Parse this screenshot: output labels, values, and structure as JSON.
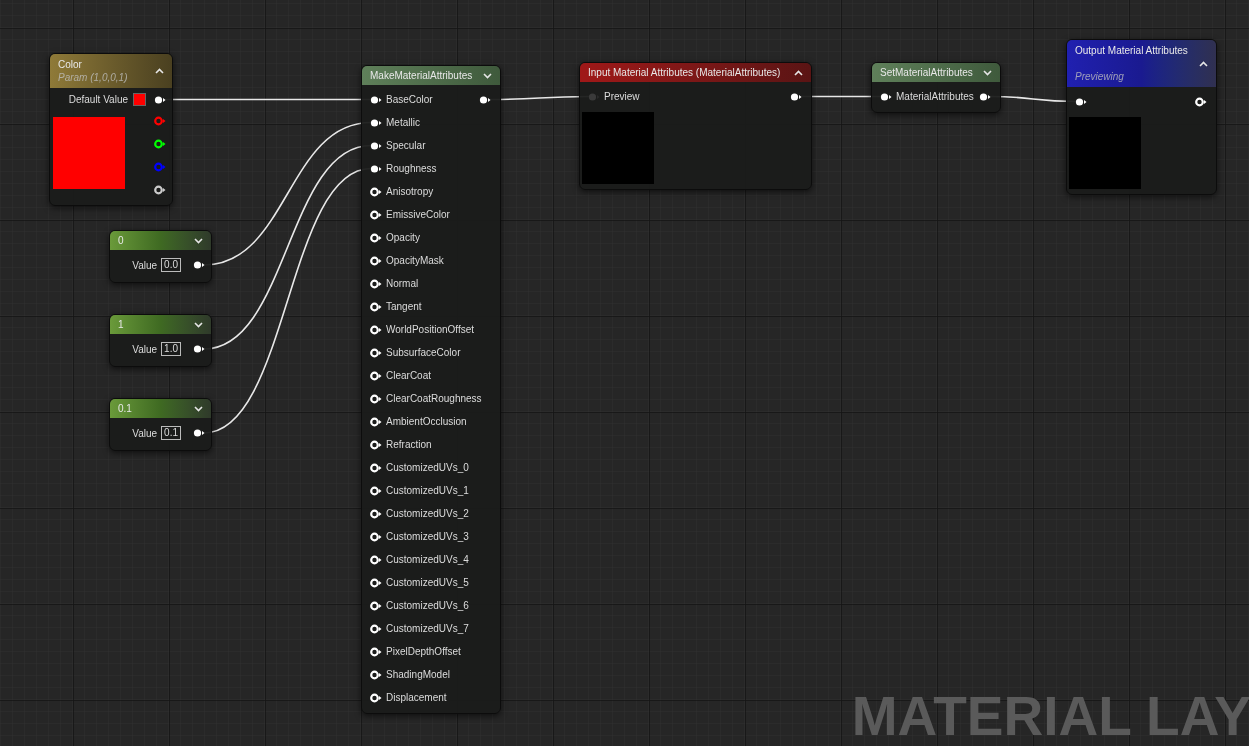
{
  "nodes": [
    {
      "kind": "param",
      "title": "Color",
      "subtitle": "Param (1,0,0,1)",
      "expanded": true,
      "default_label": "Default Value",
      "outputs": [
        {
          "color": "#ffffff",
          "connected": true
        },
        {
          "color": "#ff0000",
          "connected": false
        },
        {
          "color": "#00ff00",
          "connected": false
        },
        {
          "color": "#0000ff",
          "connected": false
        },
        {
          "color": "#cccccc",
          "connected": false
        }
      ]
    },
    {
      "kind": "constant",
      "title": "0",
      "expanded": false,
      "value_label": "Value",
      "value": "0.0",
      "outputs": [
        {
          "color": "#ffffff",
          "connected": true
        }
      ]
    },
    {
      "kind": "constant",
      "title": "1",
      "expanded": false,
      "value_label": "Value",
      "value": "1.0",
      "outputs": [
        {
          "color": "#ffffff",
          "connected": true
        }
      ]
    },
    {
      "kind": "constant",
      "title": "0.1",
      "expanded": false,
      "value_label": "Value",
      "value": "0.1",
      "outputs": [
        {
          "color": "#ffffff",
          "connected": true
        }
      ]
    },
    {
      "kind": "function",
      "title": "MakeMaterialAttributes",
      "expanded": false,
      "inputs": [
        {
          "label": "BaseColor",
          "connected": true
        },
        {
          "label": "Metallic",
          "connected": true
        },
        {
          "label": "Specular",
          "connected": true
        },
        {
          "label": "Roughness",
          "connected": true
        },
        {
          "label": "Anisotropy",
          "connected": false
        },
        {
          "label": "EmissiveColor",
          "connected": false
        },
        {
          "label": "Opacity",
          "connected": false
        },
        {
          "label": "OpacityMask",
          "connected": false
        },
        {
          "label": "Normal",
          "connected": false
        },
        {
          "label": "Tangent",
          "connected": false
        },
        {
          "label": "WorldPositionOffset",
          "connected": false
        },
        {
          "label": "SubsurfaceColor",
          "connected": false
        },
        {
          "label": "ClearCoat",
          "connected": false
        },
        {
          "label": "ClearCoatRoughness",
          "connected": false
        },
        {
          "label": "AmbientOcclusion",
          "connected": false
        },
        {
          "label": "Refraction",
          "connected": false
        },
        {
          "label": "CustomizedUVs_0",
          "connected": false
        },
        {
          "label": "CustomizedUVs_1",
          "connected": false
        },
        {
          "label": "CustomizedUVs_2",
          "connected": false
        },
        {
          "label": "CustomizedUVs_3",
          "connected": false
        },
        {
          "label": "CustomizedUVs_4",
          "connected": false
        },
        {
          "label": "CustomizedUVs_5",
          "connected": false
        },
        {
          "label": "CustomizedUVs_6",
          "connected": false
        },
        {
          "label": "CustomizedUVs_7",
          "connected": false
        },
        {
          "label": "PixelDepthOffset",
          "connected": false
        },
        {
          "label": "ShadingModel",
          "connected": false
        },
        {
          "label": "Displacement",
          "connected": false
        }
      ],
      "outputs": [
        {
          "color": "#ffffff",
          "connected": true
        }
      ]
    },
    {
      "kind": "input",
      "title": "Input Material Attributes (MaterialAttributes)",
      "expanded": true,
      "inputs": [
        {
          "label": "Preview",
          "active": false
        }
      ],
      "outputs": [
        {
          "color": "#ffffff",
          "connected": true
        }
      ]
    },
    {
      "kind": "function",
      "title": "SetMaterialAttributes",
      "expanded": false,
      "inputs": [
        {
          "label": "MaterialAttributes",
          "connected": true
        }
      ],
      "outputs": [
        {
          "color": "#ffffff",
          "connected": true
        }
      ]
    },
    {
      "kind": "output",
      "title": "Output Material Attributes",
      "subtitle": "Previewing",
      "expanded": true,
      "inputs": [
        {
          "connected": true
        }
      ],
      "outputs": [
        {
          "color": "#ffffff",
          "connected": false
        }
      ]
    }
  ],
  "graph_label": "MATERIAL LAY"
}
